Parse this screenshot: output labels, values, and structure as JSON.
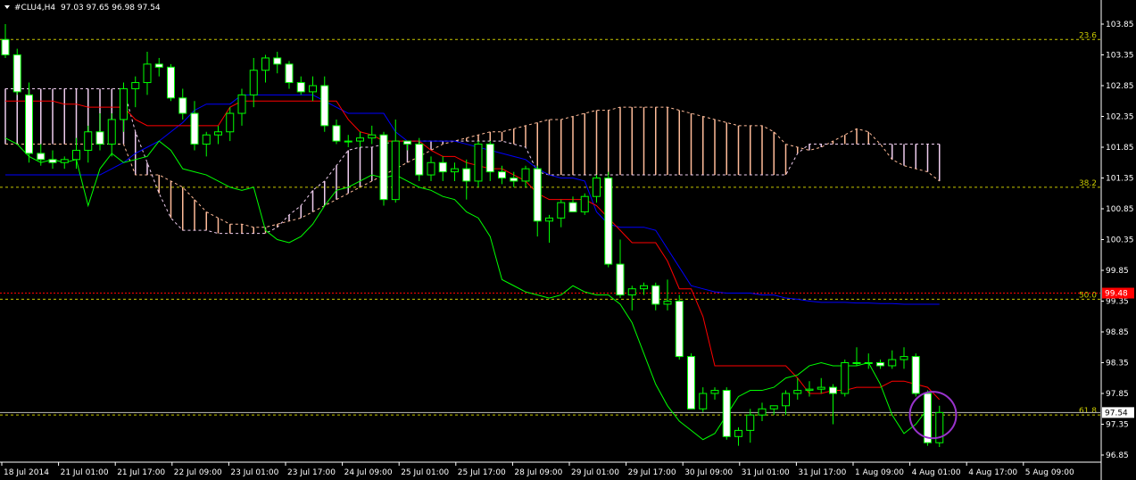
{
  "header": {
    "symbol": "#CLU4,H4",
    "ohlc": "97.03 97.65 96.98 97.54",
    "menu_arrow_icon": "triangle-down-icon"
  },
  "colors": {
    "background": "#000000",
    "bull_candle": "#000000",
    "bear_candle": "#ffffff",
    "candle_outline": "#00ff00",
    "tenkan": "#ff0000",
    "kijun": "#0000ff",
    "chikou": "#00ff00",
    "cloud_bull": "#ffbb99",
    "cloud_bear": "#eeccee",
    "fib_line": "#c8c800",
    "marker_line": "#ff0000",
    "circle": "#9933cc",
    "axis_text": "#ffffff"
  },
  "chart_data": {
    "type": "candlestick",
    "ylim": [
      96.85,
      103.85
    ],
    "y_ticks": [
      "103.85",
      "103.35",
      "102.85",
      "102.35",
      "101.85",
      "101.35",
      "100.85",
      "100.35",
      "99.85",
      "99.35",
      "98.85",
      "98.35",
      "97.85",
      "97.35",
      "96.85"
    ],
    "x_ticks": [
      "18 Jul 2014",
      "21 Jul 01:00",
      "21 Jul 17:00",
      "22 Jul 09:00",
      "23 Jul 01:00",
      "23 Jul 17:00",
      "24 Jul 09:00",
      "25 Jul 01:00",
      "25 Jul 17:00",
      "28 Jul 09:00",
      "29 Jul 01:00",
      "29 Jul 17:00",
      "30 Jul 09:00",
      "31 Jul 01:00",
      "31 Jul 17:00",
      "1 Aug 09:00",
      "4 Aug 01:00",
      "4 Aug 17:00",
      "5 Aug 09:00"
    ],
    "fib_levels": [
      {
        "label": "23.6",
        "value": 103.6
      },
      {
        "label": "38.2",
        "value": 101.2
      },
      {
        "label": "50.0",
        "value": 99.38
      },
      {
        "label": "61.8",
        "value": 97.5
      }
    ],
    "price_markers": [
      {
        "label": "99.48",
        "value": 99.48
      },
      {
        "label": "97.54",
        "value": 97.54
      }
    ],
    "candles": [
      {
        "o": 103.6,
        "h": 103.85,
        "l": 103.3,
        "c": 103.35
      },
      {
        "o": 103.35,
        "h": 103.45,
        "l": 102.7,
        "c": 102.75
      },
      {
        "o": 102.7,
        "h": 102.9,
        "l": 101.6,
        "c": 101.75
      },
      {
        "o": 101.75,
        "h": 101.9,
        "l": 101.55,
        "c": 101.65
      },
      {
        "o": 101.65,
        "h": 101.8,
        "l": 101.5,
        "c": 101.6
      },
      {
        "o": 101.6,
        "h": 101.7,
        "l": 101.5,
        "c": 101.65
      },
      {
        "o": 101.65,
        "h": 102.0,
        "l": 101.5,
        "c": 101.8
      },
      {
        "o": 101.8,
        "h": 102.2,
        "l": 101.6,
        "c": 102.1
      },
      {
        "o": 102.1,
        "h": 102.4,
        "l": 101.8,
        "c": 101.9
      },
      {
        "o": 101.9,
        "h": 102.4,
        "l": 101.7,
        "c": 102.3
      },
      {
        "o": 102.3,
        "h": 102.9,
        "l": 102.1,
        "c": 102.8
      },
      {
        "o": 102.8,
        "h": 103.0,
        "l": 102.5,
        "c": 102.9
      },
      {
        "o": 102.9,
        "h": 103.4,
        "l": 102.7,
        "c": 103.2
      },
      {
        "o": 103.2,
        "h": 103.3,
        "l": 103.0,
        "c": 103.15
      },
      {
        "o": 103.15,
        "h": 103.2,
        "l": 102.6,
        "c": 102.65
      },
      {
        "o": 102.65,
        "h": 102.8,
        "l": 102.3,
        "c": 102.4
      },
      {
        "o": 102.4,
        "h": 102.6,
        "l": 101.8,
        "c": 101.9
      },
      {
        "o": 101.9,
        "h": 102.1,
        "l": 101.7,
        "c": 102.05
      },
      {
        "o": 102.05,
        "h": 102.2,
        "l": 101.9,
        "c": 102.1
      },
      {
        "o": 102.1,
        "h": 102.5,
        "l": 101.95,
        "c": 102.4
      },
      {
        "o": 102.4,
        "h": 102.8,
        "l": 102.2,
        "c": 102.7
      },
      {
        "o": 102.7,
        "h": 103.3,
        "l": 102.5,
        "c": 103.1
      },
      {
        "o": 103.1,
        "h": 103.35,
        "l": 102.9,
        "c": 103.3
      },
      {
        "o": 103.3,
        "h": 103.4,
        "l": 103.05,
        "c": 103.2
      },
      {
        "o": 103.2,
        "h": 103.25,
        "l": 102.8,
        "c": 102.9
      },
      {
        "o": 102.9,
        "h": 103.0,
        "l": 102.7,
        "c": 102.75
      },
      {
        "o": 102.75,
        "h": 103.0,
        "l": 102.6,
        "c": 102.85
      },
      {
        "o": 102.85,
        "h": 103.0,
        "l": 102.1,
        "c": 102.2
      },
      {
        "o": 102.2,
        "h": 102.3,
        "l": 101.9,
        "c": 101.95
      },
      {
        "o": 101.95,
        "h": 102.05,
        "l": 101.85,
        "c": 101.95
      },
      {
        "o": 101.95,
        "h": 102.1,
        "l": 101.85,
        "c": 102.0
      },
      {
        "o": 102.0,
        "h": 102.2,
        "l": 101.9,
        "c": 102.05
      },
      {
        "o": 102.05,
        "h": 102.1,
        "l": 100.9,
        "c": 101.0
      },
      {
        "o": 101.0,
        "h": 102.3,
        "l": 100.95,
        "c": 101.95
      },
      {
        "o": 101.95,
        "h": 101.95,
        "l": 101.8,
        "c": 101.9
      },
      {
        "o": 101.9,
        "h": 102.0,
        "l": 101.3,
        "c": 101.4
      },
      {
        "o": 101.4,
        "h": 101.7,
        "l": 101.3,
        "c": 101.6
      },
      {
        "o": 101.6,
        "h": 101.7,
        "l": 101.3,
        "c": 101.45
      },
      {
        "o": 101.45,
        "h": 101.6,
        "l": 101.3,
        "c": 101.5
      },
      {
        "o": 101.5,
        "h": 101.65,
        "l": 101.0,
        "c": 101.3
      },
      {
        "o": 101.3,
        "h": 101.95,
        "l": 101.2,
        "c": 101.9
      },
      {
        "o": 101.9,
        "h": 101.95,
        "l": 101.3,
        "c": 101.45
      },
      {
        "o": 101.45,
        "h": 101.55,
        "l": 101.25,
        "c": 101.35
      },
      {
        "o": 101.35,
        "h": 101.45,
        "l": 101.2,
        "c": 101.3
      },
      {
        "o": 101.3,
        "h": 101.55,
        "l": 101.2,
        "c": 101.5
      },
      {
        "o": 101.5,
        "h": 101.55,
        "l": 100.4,
        "c": 100.65
      },
      {
        "o": 100.65,
        "h": 100.75,
        "l": 100.3,
        "c": 100.7
      },
      {
        "o": 100.7,
        "h": 101.0,
        "l": 100.55,
        "c": 100.95
      },
      {
        "o": 100.95,
        "h": 101.05,
        "l": 100.8,
        "c": 100.8
      },
      {
        "o": 100.8,
        "h": 101.1,
        "l": 100.75,
        "c": 101.05
      },
      {
        "o": 101.05,
        "h": 101.4,
        "l": 100.95,
        "c": 101.35
      },
      {
        "o": 101.35,
        "h": 101.45,
        "l": 99.9,
        "c": 99.95
      },
      {
        "o": 99.95,
        "h": 100.35,
        "l": 99.4,
        "c": 99.45
      },
      {
        "o": 99.45,
        "h": 99.6,
        "l": 99.2,
        "c": 99.55
      },
      {
        "o": 99.55,
        "h": 99.65,
        "l": 99.45,
        "c": 99.6
      },
      {
        "o": 99.6,
        "h": 99.65,
        "l": 99.2,
        "c": 99.3
      },
      {
        "o": 99.3,
        "h": 99.7,
        "l": 99.2,
        "c": 99.35
      },
      {
        "o": 99.35,
        "h": 99.45,
        "l": 98.4,
        "c": 98.45
      },
      {
        "o": 98.45,
        "h": 98.5,
        "l": 97.6,
        "c": 97.6
      },
      {
        "o": 97.6,
        "h": 97.95,
        "l": 97.55,
        "c": 97.85
      },
      {
        "o": 97.85,
        "h": 97.95,
        "l": 97.75,
        "c": 97.9
      },
      {
        "o": 97.9,
        "h": 97.95,
        "l": 97.1,
        "c": 97.15
      },
      {
        "o": 97.15,
        "h": 97.3,
        "l": 97.0,
        "c": 97.25
      },
      {
        "o": 97.25,
        "h": 97.6,
        "l": 97.05,
        "c": 97.5
      },
      {
        "o": 97.5,
        "h": 97.7,
        "l": 97.4,
        "c": 97.6
      },
      {
        "o": 97.6,
        "h": 97.65,
        "l": 97.5,
        "c": 97.65
      },
      {
        "o": 97.65,
        "h": 97.9,
        "l": 97.5,
        "c": 97.85
      },
      {
        "o": 97.85,
        "h": 98.1,
        "l": 97.75,
        "c": 97.9
      },
      {
        "o": 97.9,
        "h": 98.05,
        "l": 97.8,
        "c": 97.92
      },
      {
        "o": 97.92,
        "h": 98.1,
        "l": 97.85,
        "c": 97.95
      },
      {
        "o": 97.95,
        "h": 98.0,
        "l": 97.35,
        "c": 97.85
      },
      {
        "o": 97.85,
        "h": 98.4,
        "l": 97.8,
        "c": 98.35
      },
      {
        "o": 98.35,
        "h": 98.6,
        "l": 98.3,
        "c": 98.35
      },
      {
        "o": 98.35,
        "h": 98.5,
        "l": 98.25,
        "c": 98.35
      },
      {
        "o": 98.35,
        "h": 98.4,
        "l": 98.25,
        "c": 98.3
      },
      {
        "o": 98.3,
        "h": 98.55,
        "l": 98.25,
        "c": 98.4
      },
      {
        "o": 98.4,
        "h": 98.6,
        "l": 98.25,
        "c": 98.45
      },
      {
        "o": 98.45,
        "h": 98.5,
        "l": 97.8,
        "c": 97.85
      },
      {
        "o": 97.85,
        "h": 97.9,
        "l": 97.0,
        "c": 97.05
      },
      {
        "o": 97.05,
        "h": 97.65,
        "l": 96.98,
        "c": 97.54
      }
    ],
    "tenkan": [
      102.6,
      102.6,
      102.6,
      102.6,
      102.6,
      102.55,
      102.55,
      102.5,
      102.5,
      102.5,
      102.5,
      102.3,
      102.2,
      102.2,
      102.2,
      102.2,
      102.2,
      102.2,
      102.2,
      102.5,
      102.6,
      102.6,
      102.6,
      102.6,
      102.6,
      102.6,
      102.6,
      102.6,
      102.6,
      102.3,
      102.1,
      102.05,
      101.95,
      101.95,
      101.95,
      101.95,
      101.8,
      101.7,
      101.7,
      101.6,
      101.55,
      101.5,
      101.5,
      101.4,
      101.3,
      101.1,
      101.0,
      101.0,
      101.0,
      101.0,
      100.9,
      100.7,
      100.5,
      100.3,
      100.3,
      100.3,
      100.0,
      99.55,
      99.55,
      99.1,
      98.3,
      98.3,
      98.3,
      98.3,
      98.3,
      98.3,
      98.3,
      98.1,
      97.85,
      97.85,
      97.9,
      97.9,
      97.95,
      97.95,
      97.95,
      98.05,
      98.05,
      98.0,
      97.95,
      97.75
    ],
    "kijun": [
      101.4,
      101.4,
      101.4,
      101.4,
      101.4,
      101.4,
      101.4,
      101.4,
      101.4,
      101.5,
      101.6,
      101.75,
      101.85,
      101.95,
      102.1,
      102.25,
      102.45,
      102.55,
      102.55,
      102.55,
      102.7,
      102.7,
      102.7,
      102.7,
      102.7,
      102.7,
      102.7,
      102.6,
      102.5,
      102.4,
      102.4,
      102.4,
      102.4,
      102.1,
      101.95,
      101.95,
      101.95,
      101.95,
      101.95,
      101.9,
      101.85,
      101.8,
      101.75,
      101.7,
      101.65,
      101.5,
      101.4,
      101.35,
      101.35,
      101.3,
      100.8,
      100.6,
      100.55,
      100.55,
      100.55,
      100.5,
      100.2,
      99.9,
      99.6,
      99.55,
      99.5,
      99.48,
      99.48,
      99.48,
      99.45,
      99.45,
      99.4,
      99.38,
      99.35,
      99.33,
      99.33,
      99.33,
      99.32,
      99.32,
      99.31,
      99.31,
      99.3,
      99.3,
      99.3,
      99.3
    ],
    "senkou_a": [
      101.9,
      101.9,
      101.9,
      101.9,
      101.9,
      101.9,
      101.9,
      101.9,
      101.9,
      101.9,
      101.9,
      101.4,
      101.4,
      101.4,
      101.3,
      101.2,
      101.0,
      100.8,
      100.7,
      100.6,
      100.6,
      100.55,
      100.55,
      100.6,
      100.65,
      100.7,
      100.8,
      100.9,
      101.0,
      101.1,
      101.2,
      101.3,
      101.4,
      101.5,
      101.6,
      101.7,
      101.8,
      101.9,
      101.95,
      102.0,
      102.05,
      102.1,
      102.1,
      102.15,
      102.2,
      102.25,
      102.3,
      102.3,
      102.35,
      102.4,
      102.45,
      102.45,
      102.5,
      102.5,
      102.5,
      102.5,
      102.5,
      102.45,
      102.4,
      102.35,
      102.3,
      102.25,
      102.2,
      102.2,
      102.2,
      102.1,
      101.9,
      101.85,
      101.8,
      101.85,
      101.95,
      102.05,
      102.15,
      102.1,
      101.9,
      101.65,
      101.55,
      101.5,
      101.45,
      101.3
    ],
    "senkou_b": [
      102.8,
      102.8,
      102.8,
      102.8,
      102.8,
      102.8,
      102.8,
      102.8,
      102.8,
      102.8,
      102.8,
      102.1,
      101.6,
      101.1,
      100.7,
      100.5,
      100.5,
      100.5,
      100.45,
      100.45,
      100.45,
      100.45,
      100.45,
      100.55,
      100.75,
      100.9,
      101.15,
      101.3,
      101.55,
      101.8,
      101.85,
      101.85,
      101.9,
      101.95,
      101.95,
      101.95,
      101.95,
      101.95,
      101.95,
      101.95,
      101.95,
      101.95,
      101.95,
      101.9,
      101.85,
      101.45,
      101.4,
      101.4,
      101.4,
      101.4,
      101.4,
      101.4,
      101.4,
      101.4,
      101.4,
      101.4,
      101.4,
      101.4,
      101.4,
      101.4,
      101.4,
      101.4,
      101.4,
      101.4,
      101.4,
      101.4,
      101.4,
      101.75,
      101.9,
      101.9,
      101.9,
      101.9,
      101.9,
      101.9,
      101.9,
      101.9,
      101.9,
      101.9,
      101.9,
      101.9
    ],
    "chikou": [
      102.0,
      101.9,
      101.7,
      101.6,
      101.65,
      101.6,
      101.65,
      100.9,
      101.5,
      101.75,
      101.6,
      101.65,
      101.7,
      101.95,
      101.8,
      101.5,
      101.45,
      101.4,
      101.3,
      101.2,
      101.15,
      101.2,
      100.5,
      100.35,
      100.3,
      100.4,
      100.6,
      100.9,
      101.15,
      101.2,
      101.3,
      101.4,
      101.35,
      101.4,
      101.3,
      101.2,
      101.15,
      101.05,
      101.0,
      100.8,
      100.7,
      100.4,
      99.7,
      99.6,
      99.5,
      99.45,
      99.4,
      99.45,
      99.6,
      99.5,
      99.45,
      99.45,
      99.3,
      99.0,
      98.5,
      98.0,
      97.65,
      97.4,
      97.25,
      97.1,
      97.2,
      97.5,
      97.8,
      97.9,
      97.9,
      97.95,
      98.1,
      98.15,
      98.3,
      98.35,
      98.3,
      98.3,
      98.3,
      98.35,
      98.0,
      97.5,
      97.2,
      97.35,
      97.6
    ]
  }
}
